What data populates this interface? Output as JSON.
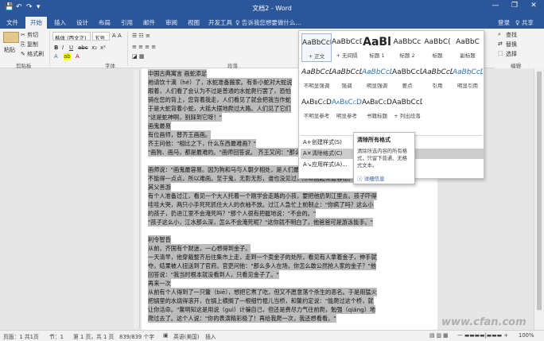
{
  "window": {
    "title": "文档2 - Word",
    "minimize": "—",
    "restore": "❐",
    "close": "✕"
  },
  "qat": {
    "save": "💾",
    "undo": "↶",
    "redo": "↷",
    "customize": "▾"
  },
  "tabs": [
    "文件",
    "开始",
    "插入",
    "设计",
    "布局",
    "引用",
    "邮件",
    "审阅",
    "视图",
    "开发工具"
  ],
  "active_tab": "开始",
  "tell_me": "♀ 告诉我您想要做什么...",
  "account": {
    "login": "登录",
    "share": "♀ 共享"
  },
  "clipboard": {
    "paste": "粘贴",
    "cut": "✂ 剪切",
    "copy": "⎘ 复制",
    "format_painter": "✎ 格式刷",
    "group": "剪贴板"
  },
  "font": {
    "name": "楷体 (西文正)",
    "size": "五号",
    "group": "字体"
  },
  "paragraph": {
    "group": "段落"
  },
  "editing": {
    "find": "查找",
    "replace": "替换",
    "select": "选择",
    "group": "编辑"
  },
  "styles_gallery": [
    {
      "preview": "AaBbCcDı",
      "name": "+ 正文",
      "selected": true
    },
    {
      "preview": "AaBbCcDı",
      "name": "+ 无间隔"
    },
    {
      "preview": "AaBl",
      "name": "标题 1",
      "big": true
    },
    {
      "preview": "AaBbCc",
      "name": "标题 2"
    },
    {
      "preview": "AaBbC(",
      "name": "标题"
    },
    {
      "preview": "AaBbC",
      "name": "副标题"
    },
    {
      "preview": "AaBbCcDı",
      "name": "不明显强调",
      "italic": true
    },
    {
      "preview": "AaBbCcDı",
      "name": "强调",
      "italic": true
    },
    {
      "preview": "AaBbCcDı",
      "name": "明显强调",
      "italic": true,
      "blue": true
    },
    {
      "preview": "AaBbCcDı",
      "name": "要点"
    },
    {
      "preview": "AaBbCcDı",
      "name": "引用",
      "italic": true
    },
    {
      "preview": "AaBbCcDı",
      "name": "明显引用",
      "italic": true,
      "blue": true
    },
    {
      "preview": "AaBbCcDı",
      "name": "不明显参考",
      "caps": true
    },
    {
      "preview": "AaBbCcDı",
      "name": "明显参考",
      "caps": true,
      "blue": true
    },
    {
      "preview": "AaBbCcDı",
      "name": "书籍标题",
      "caps": true
    },
    {
      "preview": "AaBbCcDı",
      "name": "+ 列出段落"
    }
  ],
  "styles_menu": [
    {
      "icon": "A+",
      "label": "创建样式(S)"
    },
    {
      "icon": "A✕",
      "label": "清除格式(C)",
      "hover": true
    },
    {
      "icon": "A↘",
      "label": "应用样式(A)..."
    }
  ],
  "tooltip": {
    "title": "清除所有格式",
    "body": "清除所选内容的所有格式，只留下普通、无格式文本。",
    "link": "详细信息"
  },
  "document_lines": [
    {
      "text": "中国古典寓言  画蛇添足",
      "hl": true
    },
    {
      "text": "祂请饮十滴（hé）了，水蛇准备搬家。有条小蛇对大蛇说",
      "hl": true
    },
    {
      "text": "跟着，人们看了会认为不过是普通的水蛇爬行罢了，恐怕",
      "hl": true
    },
    {
      "text": "骑在您的背上，您背着我走，人们看见了就会把我当作蛇",
      "hl": true
    },
    {
      "text": "于是大蛇背着小蛇，大摇大摆地爬过大路。人们见了它们",
      "hl": true
    },
    {
      "text": "\"这是蛇神啊，别踩到它呀！\"",
      "hl": true
    },
    {
      "text": "画鬼最易",
      "hl": true
    },
    {
      "text": "有位画师，替齐王画画。",
      "hl": true
    },
    {
      "text": "齐王问他：\"相比之下，什么东西最难画？\"",
      "hl": true
    },
    {
      "text": "\"画狗、画马，都是最难的。\"画师回答说。 齐王又问：\"那么，画什么最容易？\"",
      "hl": true
    },
    {
      "text": "",
      "hl": false
    },
    {
      "text": "画师说：\"画鬼最容易。因为狗和马与人朝夕相处，是人们最熟悉的东西，要画",
      "hl": true
    },
    {
      "text": "不能得一点点，所以难画。至于鬼，无影无形，谁也没见过，所以画起来最容易。",
      "hl": true
    },
    {
      "text": "其父善游",
      "hl": true
    },
    {
      "text": "有个人准备过江，看见一个大人托着一个刚学会走路的小孩，要把他扔到江里去。孩子吓得",
      "hl": true
    },
    {
      "text": "哇哇大哭，两只小手死死抓住大人的衣袖不放。过江人急忙上前制止：\"你疯了吗？这么小",
      "hl": true
    },
    {
      "text": "的孩子，扔进江里不会淹死吗？\"那个人很有把握地说：\"不会的。\"",
      "hl": true
    },
    {
      "text": "\"孩子这么小，江水那么深，怎么不会淹死呢？\"这你就不明白了，他爸爸可是游泳能手。\"",
      "hl": true
    },
    {
      "text": "",
      "hl": false
    },
    {
      "text": "利令智昏",
      "hl": true
    },
    {
      "text": "从前，齐国有个财迷，一心想得到金子。",
      "hl": true
    },
    {
      "text": "一天清早，他穿戴整齐后往集市上走，走到一个卖金子的处所，看见有人拿着金子，伸手就",
      "hl": true
    },
    {
      "text": "夺。结果被人扭送到了官府。官吏问他：\"那么多人在场，你怎么敢公然抢人家的金子？\"他",
      "hl": true
    },
    {
      "text": "回答说：\"我当时根本就没看到人，只看见金子了。\"",
      "hl": true
    },
    {
      "text": "再来一次",
      "hl": true
    },
    {
      "text": "从前有个人得到了一只鳖（biē），想把它煮了吃，但又不愿意落个杀生的恶名。于是用猛火",
      "hl": true
    },
    {
      "text": "把锅里的水烧得滚开，在锅上横搁了一根细竹棍儿当桥，和鳖约定说：\"能爬过这个桥，就",
      "hl": true
    },
    {
      "text": "让你活命。\"鳖明知这是用说（guì）计骗自己，但还是费尽力气往前爬，勉强（qiáng）地",
      "hl": true
    },
    {
      "text": "爬过去了。这个人说：\"你的表演精彩极了！再给我爬一次，我还想看看。\"",
      "hl": true
    }
  ],
  "status": {
    "page": "页面：1 共1页",
    "section": "节：1",
    "position": "第 1 页，共 1 页",
    "words": "839/839 个字",
    "lang": "英语(美国)",
    "mode": "插入",
    "zoom": "100%"
  },
  "watermark": "www.cfan.com"
}
